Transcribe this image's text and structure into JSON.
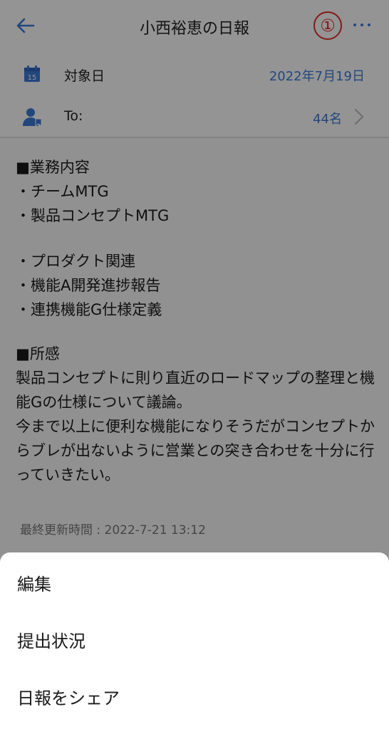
{
  "header": {
    "title": "小西裕恵の日報",
    "callout_marker": "①"
  },
  "info": {
    "date_label": "対象日",
    "date_value": "2022年7月19日",
    "calendar_day": "15",
    "to_label": "To:",
    "to_value": "44名"
  },
  "report": {
    "work_heading": "■業務内容",
    "work_items": [
      "・チームMTG",
      "・製品コンセプトMTG"
    ],
    "product_items": [
      "・プロダクト関連",
      "・機能A開発進捗報告",
      "・連携機能G仕様定義"
    ],
    "impression_heading": "■所感",
    "impression_text_1": "製品コンセプトに則り直近のロードマップの整理と機能Gの仕様について議論。",
    "impression_text_2": "今まで以上に便利な機能になりそうだがコンセプトからブレが出ないように営業との突き合わせを十分に行っていきたい。"
  },
  "last_updated": "最終更新時間 : 2022-7-21 13:12",
  "sheet": {
    "items": [
      "編集",
      "提出状況",
      "日報をシェア"
    ]
  },
  "colors": {
    "accent": "#3b7bd8",
    "callout": "#e52b2b"
  }
}
